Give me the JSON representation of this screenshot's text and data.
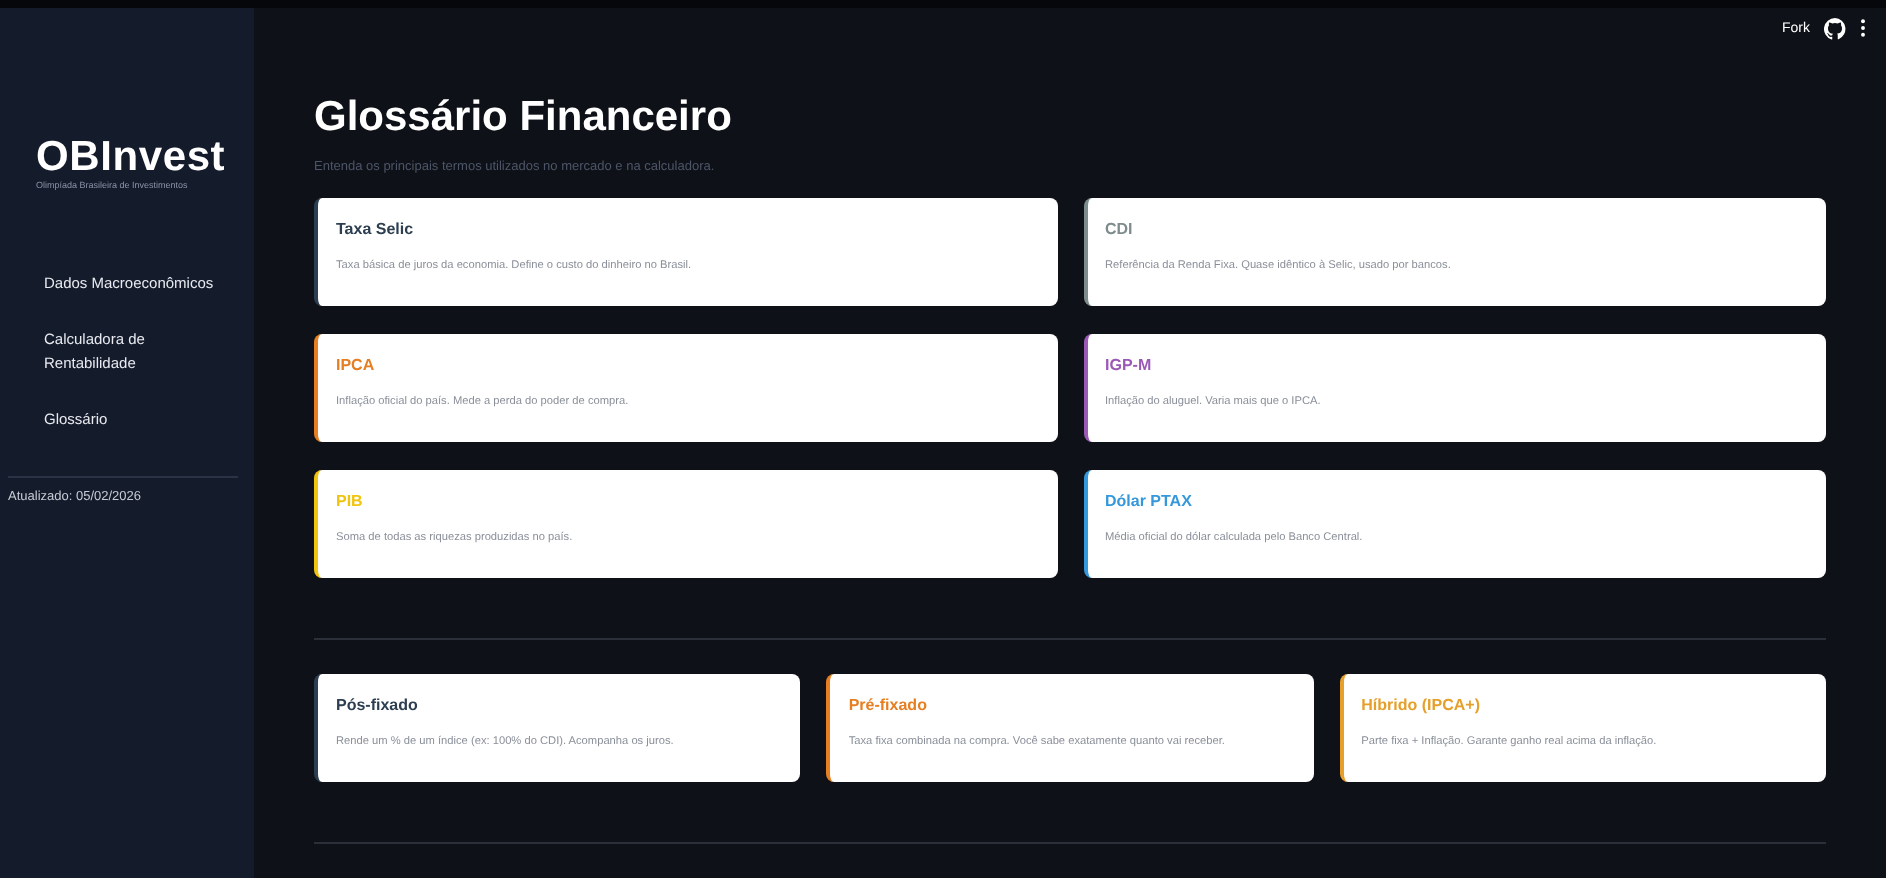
{
  "header": {
    "fork_label": "Fork"
  },
  "sidebar": {
    "logo": "OBInvest",
    "logo_subtitle": "Olimpíada Brasileira de Investimentos",
    "items": [
      {
        "label": "Dados Macroeconômicos",
        "selected": false
      },
      {
        "label": "Calculadora de Rentabilidade",
        "selected": false
      },
      {
        "label": "Glossário",
        "selected": false
      }
    ],
    "updated": "Atualizado: 05/02/2026"
  },
  "title": "Glossário Financeiro",
  "subtitle": "Entenda os principais termos utilizados no mercado e na calculadora.",
  "terms": [
    {
      "term": "Taxa Selic",
      "description": "Taxa básica de juros da economia. Define o custo do dinheiro no Brasil.",
      "color": "#2c3e50"
    },
    {
      "term": "CDI",
      "description": "Referência da Renda Fixa. Quase idêntico à Selic, usado por bancos.",
      "color": "#7f8c8d"
    },
    {
      "term": "IPCA",
      "description": "Inflação oficial do país. Mede a perda do poder de compra.",
      "color": "#e67e22"
    },
    {
      "term": "IGP-M",
      "description": "Inflação do aluguel. Varia mais que o IPCA.",
      "color": "#9b59b6"
    },
    {
      "term": "PIB",
      "description": "Soma de todas as riquezas produzidas no país.",
      "color": "#f1c40f"
    },
    {
      "term": "Dólar PTAX",
      "description": "Média oficial do dólar calculada pelo Banco Central.",
      "color": "#3498db"
    }
  ],
  "investment_types": [
    {
      "term": "Pós-fixado",
      "description": "Rende um % de um índice (ex: 100% do CDI). Acompanha os juros.",
      "color": "#2c3e50"
    },
    {
      "term": "Pré-fixado",
      "description": "Taxa fixa combinada na compra. Você sabe exatamente quanto vai receber.",
      "color": "#e67e22"
    },
    {
      "term": "Híbrido (IPCA+)",
      "description": "Parte fixa + Inflação. Garante ganho real acima da inflação.",
      "color": "#e59f2a"
    }
  ]
}
